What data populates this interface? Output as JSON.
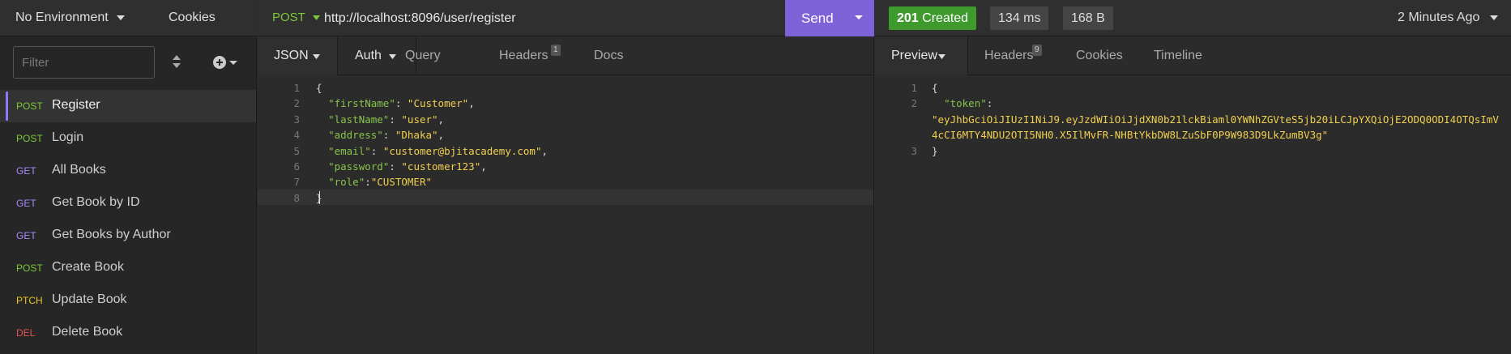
{
  "sidebar": {
    "environment_label": "No Environment",
    "cookies_label": "Cookies",
    "filter_placeholder": "Filter",
    "requests": [
      {
        "method": "POST",
        "method_color": "#7fc83a",
        "name": "Register",
        "active": true
      },
      {
        "method": "POST",
        "method_color": "#7fc83a",
        "name": "Login"
      },
      {
        "method": "GET",
        "method_color": "#a98cf5",
        "name": "All Books"
      },
      {
        "method": "GET",
        "method_color": "#a98cf5",
        "name": "Get Book by ID"
      },
      {
        "method": "GET",
        "method_color": "#a98cf5",
        "name": "Get Books by Author"
      },
      {
        "method": "POST",
        "method_color": "#7fc83a",
        "name": "Create Book"
      },
      {
        "method": "PTCH",
        "method_color": "#e6c628",
        "name": "Update Book"
      },
      {
        "method": "DEL",
        "method_color": "#e5554f",
        "name": "Delete Book"
      }
    ]
  },
  "request": {
    "method": "POST",
    "url": "http://localhost:8096/user/register",
    "send_label": "Send",
    "tabs": {
      "body": "JSON",
      "auth": "Auth",
      "query": "Query",
      "headers": "Headers",
      "headers_count": "1",
      "docs": "Docs"
    },
    "body_lines": [
      {
        "num": "1",
        "parts": [
          {
            "t": "{",
            "c": "p"
          }
        ]
      },
      {
        "num": "2",
        "parts": [
          {
            "t": "  ",
            "c": "p"
          },
          {
            "t": "\"firstName\"",
            "c": "k"
          },
          {
            "t": ": ",
            "c": "p"
          },
          {
            "t": "\"Customer\"",
            "c": "s"
          },
          {
            "t": ",",
            "c": "p"
          }
        ]
      },
      {
        "num": "3",
        "parts": [
          {
            "t": "  ",
            "c": "p"
          },
          {
            "t": "\"lastName\"",
            "c": "k"
          },
          {
            "t": ": ",
            "c": "p"
          },
          {
            "t": "\"user\"",
            "c": "s"
          },
          {
            "t": ",",
            "c": "p"
          }
        ]
      },
      {
        "num": "4",
        "parts": [
          {
            "t": "  ",
            "c": "p"
          },
          {
            "t": "\"address\"",
            "c": "k"
          },
          {
            "t": ": ",
            "c": "p"
          },
          {
            "t": "\"Dhaka\"",
            "c": "s"
          },
          {
            "t": ",",
            "c": "p"
          }
        ]
      },
      {
        "num": "5",
        "parts": [
          {
            "t": "  ",
            "c": "p"
          },
          {
            "t": "\"email\"",
            "c": "k"
          },
          {
            "t": ": ",
            "c": "p"
          },
          {
            "t": "\"customer@bjitacademy.com\"",
            "c": "s"
          },
          {
            "t": ",",
            "c": "p"
          }
        ]
      },
      {
        "num": "6",
        "parts": [
          {
            "t": "  ",
            "c": "p"
          },
          {
            "t": "\"password\"",
            "c": "k"
          },
          {
            "t": ": ",
            "c": "p"
          },
          {
            "t": "\"customer123\"",
            "c": "s"
          },
          {
            "t": ",",
            "c": "p"
          }
        ]
      },
      {
        "num": "7",
        "parts": [
          {
            "t": "  ",
            "c": "p"
          },
          {
            "t": "\"role\"",
            "c": "k"
          },
          {
            "t": ":",
            "c": "p"
          },
          {
            "t": "\"CUSTOMER\"",
            "c": "s"
          }
        ]
      },
      {
        "num": "8",
        "parts": [
          {
            "t": "}",
            "c": "p"
          }
        ]
      }
    ]
  },
  "response": {
    "status_code": "201",
    "status_text": "Created",
    "time": "134 ms",
    "size": "168 B",
    "time_ago": "2 Minutes Ago",
    "tabs": {
      "preview": "Preview",
      "headers": "Headers",
      "headers_count": "9",
      "cookies": "Cookies",
      "timeline": "Timeline"
    },
    "body_lines": [
      {
        "num": "1",
        "parts": [
          {
            "t": "{",
            "c": "p"
          }
        ]
      },
      {
        "num": "2",
        "parts": [
          {
            "t": "  ",
            "c": "p"
          },
          {
            "t": "\"token\"",
            "c": "k"
          },
          {
            "t": ":",
            "c": "p"
          }
        ]
      },
      {
        "num": "",
        "parts": [
          {
            "t": "\"eyJhbGciOiJIUzI1NiJ9.eyJzdWIiOiJjdXN0b21lckBiaml0YWNhZGVteS5jb20iLCJpYXQiOjE2ODQ0ODI4OTQsImV",
            "c": "s"
          }
        ]
      },
      {
        "num": "",
        "parts": [
          {
            "t": "4cCI6MTY4NDU2OTI5NH0.X5IlMvFR-NHBtYkbDW8LZuSbF0P9W983D9LkZumBV3g\"",
            "c": "s"
          }
        ]
      },
      {
        "num": "3",
        "parts": [
          {
            "t": "}",
            "c": "p"
          }
        ]
      }
    ]
  },
  "colors": {
    "accent": "#7e63d8",
    "success": "#3f9a2e",
    "post": "#7fc83a",
    "get": "#a98cf5",
    "patch": "#e6c628",
    "delete": "#e5554f"
  }
}
